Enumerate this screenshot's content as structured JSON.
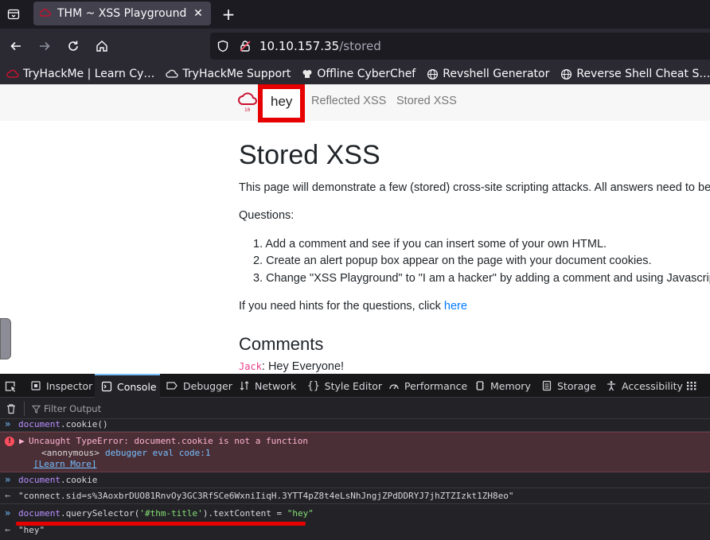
{
  "browser": {
    "tab": {
      "title": "THM ~ XSS Playground"
    },
    "url": {
      "host": "10.10.157.35",
      "path": "/stored"
    },
    "bookmarks": [
      {
        "label": "TryHackMe | Learn Cy…",
        "icon": "thm-icon"
      },
      {
        "label": "TryHackMe Support",
        "icon": "cloud-icon"
      },
      {
        "label": "Offline CyberChef",
        "icon": "chef-icon"
      },
      {
        "label": "Revshell Generator",
        "icon": "globe-icon"
      },
      {
        "label": "Reverse Shell Cheat S…",
        "icon": "globe-icon"
      }
    ]
  },
  "page": {
    "nav": {
      "brand": "hey",
      "links": [
        "Reflected XSS",
        "Stored XSS"
      ]
    },
    "heading": "Stored XSS",
    "intro": "This page will demonstrate a few (stored) cross-site scripting attacks. All answers need to be",
    "questions_label": "Questions:",
    "questions": [
      "1. Add a comment and see if you can insert some of your own HTML.",
      "2. Create an alert popup box appear on the page with your document cookies.",
      "3. Change \"XSS Playground\" to \"I am a hacker\" by adding a comment and using Javascrip"
    ],
    "hint_prefix": "If you need hints for the questions, click ",
    "hint_link": "here",
    "comments_heading": "Comments",
    "comment": {
      "user": "Jack",
      "text": ": Hey Everyone!"
    }
  },
  "devtools": {
    "tabs": [
      "Inspector",
      "Console",
      "Debugger",
      "Network",
      "Style Editor",
      "Performance",
      "Memory",
      "Storage",
      "Accessibility"
    ],
    "active_tab": "Console",
    "filter_placeholder": "Filter Output",
    "console": {
      "line1_input": {
        "obj": "document",
        "rest": ".cookie()"
      },
      "error": {
        "message": "Uncaught TypeError: document.cookie is not a function",
        "frame_name": "<anonymous>",
        "frame_loc": "debugger eval code:1",
        "learn_more": "[Learn More]"
      },
      "line2_input": {
        "obj": "document",
        "rest": ".cookie"
      },
      "line2_output": "\"connect.sid=s%3AoxbrDUO81RnvOy3GC3RfSCe6WxniIiqH.3YTT4pZ8t4eLsNhJngjZPdDDRYJ7jhZTZIzkt1ZH8eo\"",
      "line3_input": {
        "obj": "document",
        "method": ".querySelector(",
        "arg": "'#thm-title'",
        "tail": ").textContent = ",
        "value": "\"hey\""
      },
      "line3_output": "\"hey\""
    }
  },
  "colors": {
    "highlight": "#e60000",
    "link": "#007bff",
    "devtools_accent": "#75bfff"
  }
}
